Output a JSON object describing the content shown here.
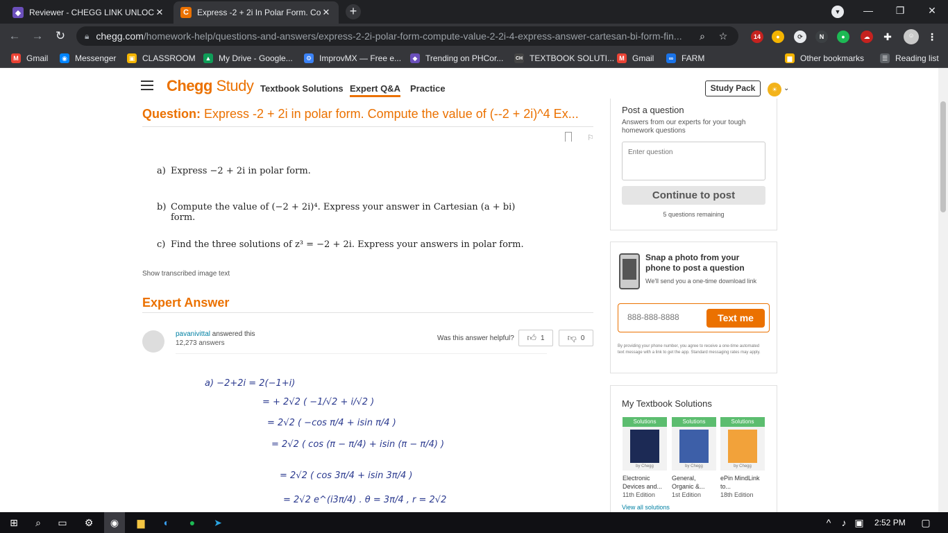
{
  "browser": {
    "tabs": [
      {
        "title": "Reviewer - CHEGG LINK UNLOCK",
        "close": "✕"
      },
      {
        "title": "Express -2 + 2i In Polar Form. Cor",
        "close": "✕"
      }
    ],
    "newtab": "+",
    "window_controls": {
      "minimize": "—",
      "maximize": "❐",
      "close": "✕"
    },
    "url_host": "chegg.com",
    "url_path": "/homework-help/questions-and-answers/express-2-2i-polar-form-compute-value-2-2i-4-express-answer-cartesan-bi-form-fin...",
    "bookmarks": [
      {
        "label": "Gmail",
        "color": "#ea4335",
        "glyph": "M"
      },
      {
        "label": "Messenger",
        "color": "#0084ff",
        "glyph": "◉"
      },
      {
        "label": "CLASSROOM",
        "color": "#f4b400",
        "glyph": "▣"
      },
      {
        "label": "My Drive - Google...",
        "color": "#0f9d58",
        "glyph": "▲"
      },
      {
        "label": "ImprovMX — Free e...",
        "color": "#3b82f6",
        "glyph": "⚙"
      },
      {
        "label": "Trending on PHCor...",
        "color": "#6b4fbb",
        "glyph": "◆"
      },
      {
        "label": "TEXTBOOK SOLUTI...",
        "color": "#444444",
        "glyph": "CH"
      },
      {
        "label": "Gmail",
        "color": "#ea4335",
        "glyph": "M"
      },
      {
        "label": "FARM",
        "color": "#1a73e8",
        "glyph": "∞"
      },
      {
        "label": "Other bookmarks",
        "color": "#f4b400",
        "glyph": "▆"
      },
      {
        "label": "Reading list",
        "color": "#5f6368",
        "glyph": "☰"
      }
    ]
  },
  "chegg": {
    "logo_main": "Chegg",
    "logo_study": "Study",
    "nav": [
      "Textbook Solutions",
      "Expert Q&A",
      "Practice"
    ],
    "study_pack": "Study Pack",
    "question_label": "Question:",
    "question_text": "Express -2 + 2i in polar form. Compute the value of (--2 + 2i)^4 Ex...",
    "problem": {
      "a_label": "a)",
      "a_text": "Express −2 + 2i in polar form.",
      "b_label": "b)",
      "b_text": "Compute the value of (−2 + 2i)⁴. Express your answer in Cartesian (a + bi)",
      "b_cont": "form.",
      "c_label": "c)",
      "c_text": "Find the three solutions of z³ = −2 + 2i. Express your answers in polar form."
    },
    "show_transcribed": "Show transcribed image text",
    "expert_answer_title": "Expert Answer",
    "answerer_name": "pavanivittal",
    "answered_this": " answered this",
    "answer_count": "12,273 answers",
    "helpful_q": "Was this answer helpful?",
    "thumbs_up_count": "1",
    "thumbs_down_count": "0",
    "handwritten": [
      "a)    −2+2i =  2(−1+i)",
      "= + 2√2 ( −1/√2 + i/√2 )",
      "= 2√2 ( −cos π/4 + isin π/4 )",
      "= 2√2 ( cos (π − π/4) + isin (π − π/4) )",
      "= 2√2 ( cos 3π/4 + isin 3π/4 )",
      "= 2√2 e^(i3π/4) .      θ = 3π/4 ,  r = 2√2"
    ],
    "sidebar": {
      "post_title": "Post a question",
      "post_sub": "Answers from our experts for your tough homework questions",
      "post_placeholder": "Enter question",
      "continue_label": "Continue to post",
      "remaining": "5 questions remaining",
      "snap_title": "Snap a photo from your phone to post a question",
      "snap_sub": "We'll send you a one-time download link",
      "phone_placeholder": "888-888-8888",
      "text_me": "Text me",
      "disclaimer": "By providing your phone number, you agree to receive a one-time automated text message with a link to get the app. Standard messaging rates may apply.",
      "mts_title": "My Textbook Solutions",
      "books": [
        {
          "banner": "Solutions",
          "title": "Electronic Devices and...",
          "edition": "11th Edition",
          "by": "by Chegg"
        },
        {
          "banner": "Solutions",
          "title": "General, Organic &...",
          "edition": "1st Edition",
          "by": "by Chegg"
        },
        {
          "banner": "Solutions",
          "title": "ePin MindLink to...",
          "edition": "18th Edition",
          "by": "by Chegg"
        }
      ],
      "view_all": "View all solutions"
    }
  },
  "taskbar": {
    "time": "2:52 PM"
  }
}
